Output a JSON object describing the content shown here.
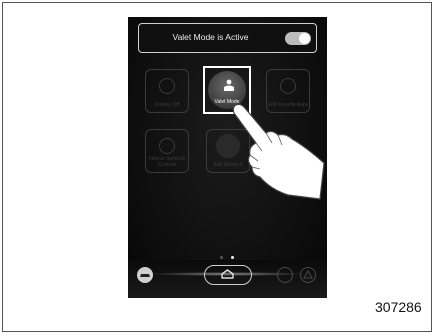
{
  "status_bar": {
    "text": "Valet Mode is Active",
    "toggle_on": true
  },
  "apps": [
    {
      "label": "Display Off",
      "icon": "power-icon",
      "highlighted": false
    },
    {
      "label": "Valet Mode",
      "icon": "valet-icon",
      "highlighted": true
    },
    {
      "label": "Edit Favorite Apps",
      "icon": "edit-icon",
      "highlighted": false
    },
    {
      "label": "Vehicle Symbols Controls",
      "icon": "vehicle-icon",
      "highlighted": false
    },
    {
      "label": "Add Shortcut",
      "icon": "add-icon",
      "highlighted": false
    }
  ],
  "pager": {
    "pages": 2,
    "active": 2
  },
  "figure_id": "307286",
  "colors": {
    "screen": "#0d0d0d",
    "highlight": "#ffffff",
    "dim_tile": "#3a3a3a"
  }
}
